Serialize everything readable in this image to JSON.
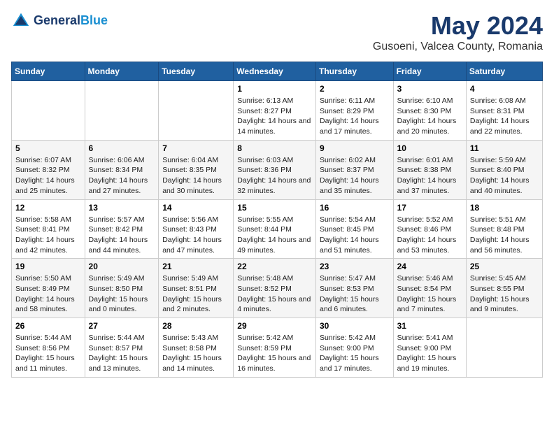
{
  "logo": {
    "line1": "General",
    "line2": "Blue"
  },
  "title": "May 2024",
  "subtitle": "Gusoeni, Valcea County, Romania",
  "days_of_week": [
    "Sunday",
    "Monday",
    "Tuesday",
    "Wednesday",
    "Thursday",
    "Friday",
    "Saturday"
  ],
  "weeks": [
    [
      {
        "num": "",
        "info": ""
      },
      {
        "num": "",
        "info": ""
      },
      {
        "num": "",
        "info": ""
      },
      {
        "num": "1",
        "info": "Sunrise: 6:13 AM\nSunset: 8:27 PM\nDaylight: 14 hours and 14 minutes."
      },
      {
        "num": "2",
        "info": "Sunrise: 6:11 AM\nSunset: 8:29 PM\nDaylight: 14 hours and 17 minutes."
      },
      {
        "num": "3",
        "info": "Sunrise: 6:10 AM\nSunset: 8:30 PM\nDaylight: 14 hours and 20 minutes."
      },
      {
        "num": "4",
        "info": "Sunrise: 6:08 AM\nSunset: 8:31 PM\nDaylight: 14 hours and 22 minutes."
      }
    ],
    [
      {
        "num": "5",
        "info": "Sunrise: 6:07 AM\nSunset: 8:32 PM\nDaylight: 14 hours and 25 minutes."
      },
      {
        "num": "6",
        "info": "Sunrise: 6:06 AM\nSunset: 8:34 PM\nDaylight: 14 hours and 27 minutes."
      },
      {
        "num": "7",
        "info": "Sunrise: 6:04 AM\nSunset: 8:35 PM\nDaylight: 14 hours and 30 minutes."
      },
      {
        "num": "8",
        "info": "Sunrise: 6:03 AM\nSunset: 8:36 PM\nDaylight: 14 hours and 32 minutes."
      },
      {
        "num": "9",
        "info": "Sunrise: 6:02 AM\nSunset: 8:37 PM\nDaylight: 14 hours and 35 minutes."
      },
      {
        "num": "10",
        "info": "Sunrise: 6:01 AM\nSunset: 8:38 PM\nDaylight: 14 hours and 37 minutes."
      },
      {
        "num": "11",
        "info": "Sunrise: 5:59 AM\nSunset: 8:40 PM\nDaylight: 14 hours and 40 minutes."
      }
    ],
    [
      {
        "num": "12",
        "info": "Sunrise: 5:58 AM\nSunset: 8:41 PM\nDaylight: 14 hours and 42 minutes."
      },
      {
        "num": "13",
        "info": "Sunrise: 5:57 AM\nSunset: 8:42 PM\nDaylight: 14 hours and 44 minutes."
      },
      {
        "num": "14",
        "info": "Sunrise: 5:56 AM\nSunset: 8:43 PM\nDaylight: 14 hours and 47 minutes."
      },
      {
        "num": "15",
        "info": "Sunrise: 5:55 AM\nSunset: 8:44 PM\nDaylight: 14 hours and 49 minutes."
      },
      {
        "num": "16",
        "info": "Sunrise: 5:54 AM\nSunset: 8:45 PM\nDaylight: 14 hours and 51 minutes."
      },
      {
        "num": "17",
        "info": "Sunrise: 5:52 AM\nSunset: 8:46 PM\nDaylight: 14 hours and 53 minutes."
      },
      {
        "num": "18",
        "info": "Sunrise: 5:51 AM\nSunset: 8:48 PM\nDaylight: 14 hours and 56 minutes."
      }
    ],
    [
      {
        "num": "19",
        "info": "Sunrise: 5:50 AM\nSunset: 8:49 PM\nDaylight: 14 hours and 58 minutes."
      },
      {
        "num": "20",
        "info": "Sunrise: 5:49 AM\nSunset: 8:50 PM\nDaylight: 15 hours and 0 minutes."
      },
      {
        "num": "21",
        "info": "Sunrise: 5:49 AM\nSunset: 8:51 PM\nDaylight: 15 hours and 2 minutes."
      },
      {
        "num": "22",
        "info": "Sunrise: 5:48 AM\nSunset: 8:52 PM\nDaylight: 15 hours and 4 minutes."
      },
      {
        "num": "23",
        "info": "Sunrise: 5:47 AM\nSunset: 8:53 PM\nDaylight: 15 hours and 6 minutes."
      },
      {
        "num": "24",
        "info": "Sunrise: 5:46 AM\nSunset: 8:54 PM\nDaylight: 15 hours and 7 minutes."
      },
      {
        "num": "25",
        "info": "Sunrise: 5:45 AM\nSunset: 8:55 PM\nDaylight: 15 hours and 9 minutes."
      }
    ],
    [
      {
        "num": "26",
        "info": "Sunrise: 5:44 AM\nSunset: 8:56 PM\nDaylight: 15 hours and 11 minutes."
      },
      {
        "num": "27",
        "info": "Sunrise: 5:44 AM\nSunset: 8:57 PM\nDaylight: 15 hours and 13 minutes."
      },
      {
        "num": "28",
        "info": "Sunrise: 5:43 AM\nSunset: 8:58 PM\nDaylight: 15 hours and 14 minutes."
      },
      {
        "num": "29",
        "info": "Sunrise: 5:42 AM\nSunset: 8:59 PM\nDaylight: 15 hours and 16 minutes."
      },
      {
        "num": "30",
        "info": "Sunrise: 5:42 AM\nSunset: 9:00 PM\nDaylight: 15 hours and 17 minutes."
      },
      {
        "num": "31",
        "info": "Sunrise: 5:41 AM\nSunset: 9:00 PM\nDaylight: 15 hours and 19 minutes."
      },
      {
        "num": "",
        "info": ""
      }
    ]
  ]
}
